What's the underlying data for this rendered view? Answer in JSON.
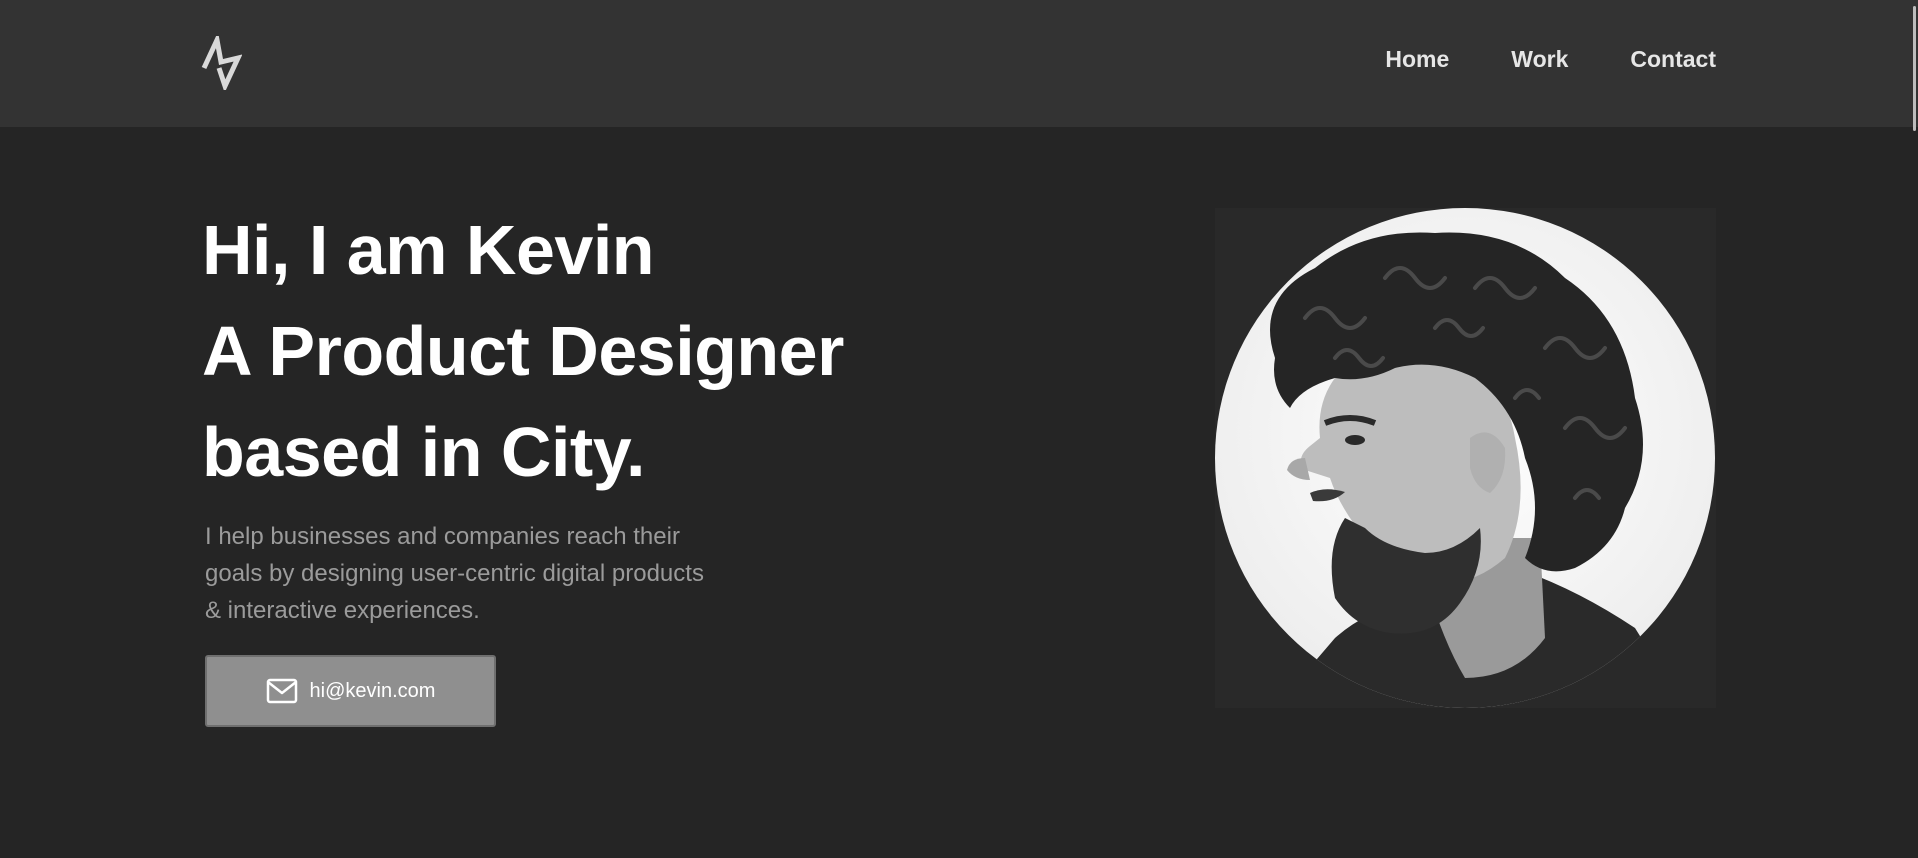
{
  "nav": {
    "logo_icon": "zigzag-logo-icon",
    "links": [
      {
        "label": "Home"
      },
      {
        "label": "Work"
      },
      {
        "label": "Contact"
      }
    ]
  },
  "hero": {
    "heading_lines": [
      "Hi, I am Kevin",
      "A Product Designer",
      "based in City."
    ],
    "description": "I help businesses and companies reach their goals by designing user-centric digital products & interactive experiences.",
    "email_button": {
      "icon": "mail-icon",
      "label": "hi@kevin.com"
    },
    "portrait_icon": "portrait-photo"
  },
  "colors": {
    "background": "#252525",
    "navbar": "#333333",
    "button": "#8f8f8f",
    "text_primary": "#ffffff",
    "text_muted": "#9b9b9b"
  }
}
